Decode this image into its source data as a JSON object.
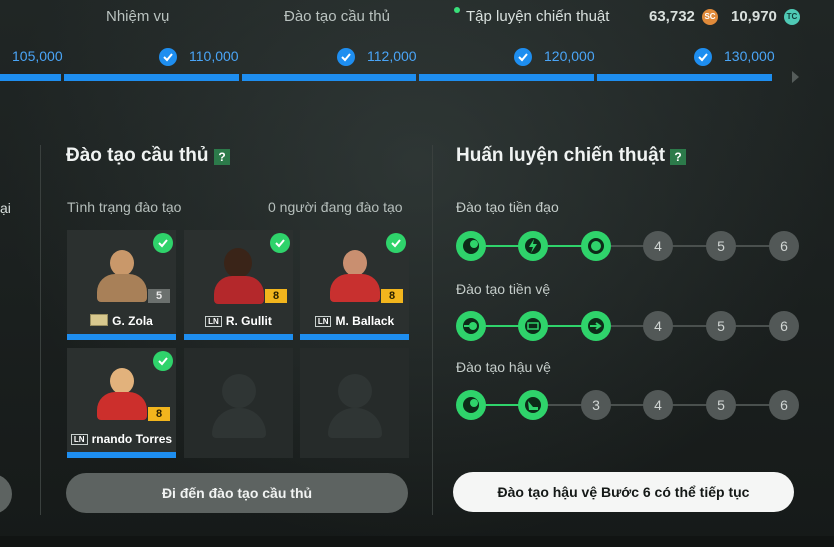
{
  "nav": {
    "tabs": [
      {
        "label": "Nhiệm vụ"
      },
      {
        "label": "Đào tạo cầu thủ"
      },
      {
        "label": "Tập luyện chiến thuật"
      }
    ],
    "currencies": [
      {
        "value": "63,732",
        "icon": "sc-coin-icon",
        "code": "SC"
      },
      {
        "value": "10,970",
        "icon": "tc-coin-icon",
        "code": "TC"
      }
    ]
  },
  "progress": {
    "rewards": [
      "105,000",
      "110,000",
      "112,000",
      "120,000",
      "130,000"
    ],
    "accent": "#1e8ef0"
  },
  "left_edge": {
    "text": "ại"
  },
  "player_training": {
    "title": "Đào tạo cầu thủ",
    "help": "?",
    "status_label": "Tình trạng đào tạo",
    "count_label": "0 người đang đào tạo",
    "cards": [
      {
        "name": "G. Zola",
        "level": "5",
        "tag": "icon",
        "done": true
      },
      {
        "name": "R. Gullit",
        "level": "8",
        "tag": "LN",
        "done": true
      },
      {
        "name": "M. Ballack",
        "level": "8",
        "tag": "LN",
        "done": true
      },
      {
        "name": "rnando Torres",
        "level": "8",
        "tag": "LN",
        "done": true
      }
    ],
    "button": "Đi đến đào tạo cầu thủ"
  },
  "tactical": {
    "title": "Huấn luyện chiến thuật",
    "help": "?",
    "rows": [
      {
        "label": "Đào tạo tiền đạo",
        "steps": [
          "",
          "",
          "",
          "4",
          "5",
          "6"
        ],
        "completed": 3
      },
      {
        "label": "Đào tạo tiền vệ",
        "steps": [
          "",
          "",
          "",
          "4",
          "5",
          "6"
        ],
        "completed": 3
      },
      {
        "label": "Đào tạo hậu vệ",
        "steps": [
          "",
          "",
          "3",
          "4",
          "5",
          "6"
        ],
        "completed": 2
      }
    ],
    "button": "Đào tạo hậu vệ Bước 6 có thể tiếp tục",
    "done_color": "#2fd36b"
  }
}
